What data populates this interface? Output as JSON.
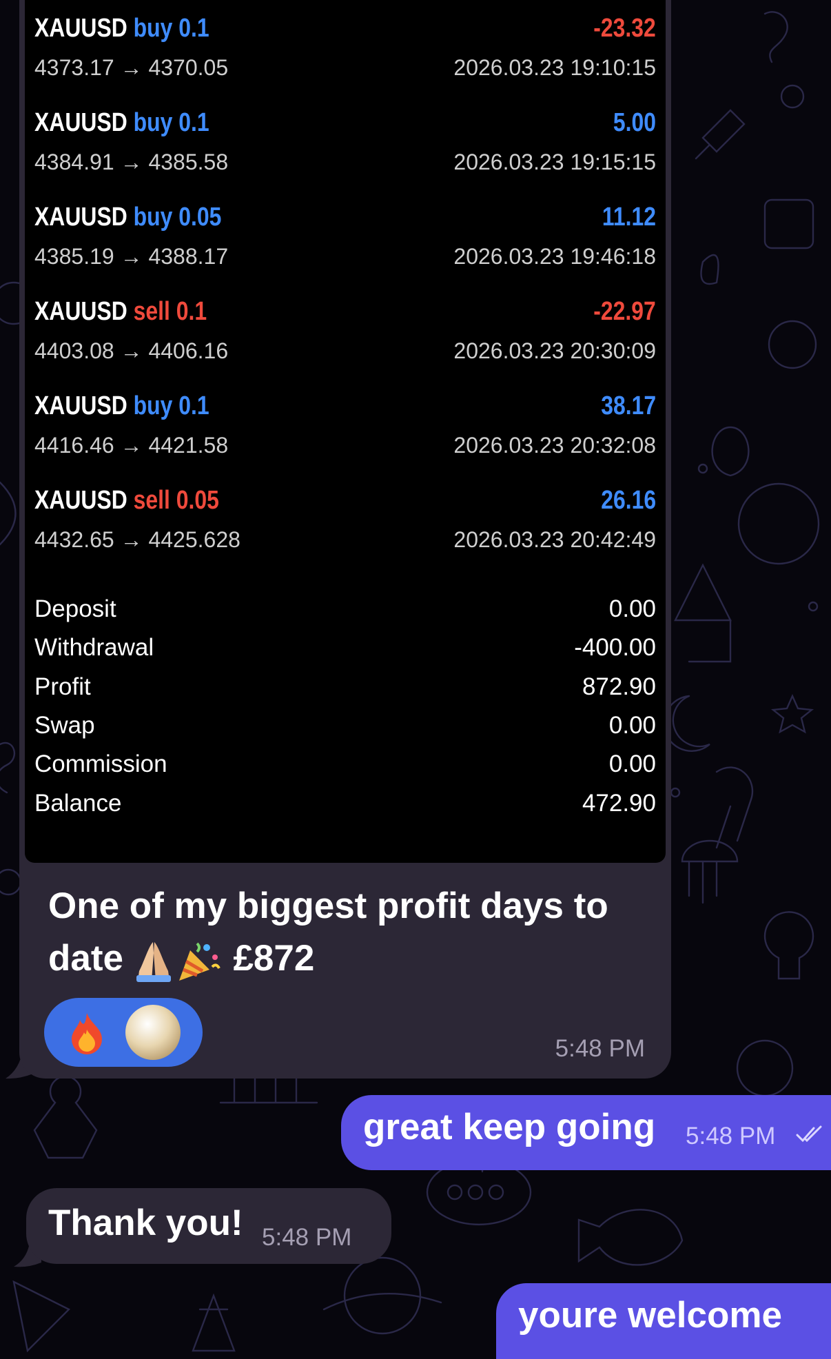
{
  "trades": [
    {
      "symbol": "XAUUSD",
      "side": "buy",
      "volume": "0.1",
      "prices": "4373.17 → 4370.05",
      "profit": "-23.32",
      "profit_sign": "neg",
      "time": "2026.03.23 19:10:15"
    },
    {
      "symbol": "XAUUSD",
      "side": "buy",
      "volume": "0.1",
      "prices": "4384.91 → 4385.58",
      "profit": "5.00",
      "profit_sign": "pos",
      "time": "2026.03.23 19:15:15"
    },
    {
      "symbol": "XAUUSD",
      "side": "buy",
      "volume": "0.05",
      "prices": "4385.19 → 4388.17",
      "profit": "11.12",
      "profit_sign": "pos",
      "time": "2026.03.23 19:46:18"
    },
    {
      "symbol": "XAUUSD",
      "side": "sell",
      "volume": "0.1",
      "prices": "4403.08 → 4406.16",
      "profit": "-22.97",
      "profit_sign": "neg",
      "time": "2026.03.23 20:30:09"
    },
    {
      "symbol": "XAUUSD",
      "side": "buy",
      "volume": "0.1",
      "prices": "4416.46 → 4421.58",
      "profit": "38.17",
      "profit_sign": "pos",
      "time": "2026.03.23 20:32:08"
    },
    {
      "symbol": "XAUUSD",
      "side": "sell",
      "volume": "0.05",
      "prices": "4432.65 → 4425.628",
      "profit": "26.16",
      "profit_sign": "pos",
      "time": "2026.03.23 20:42:49"
    }
  ],
  "summary": [
    {
      "label": "Deposit",
      "value": "0.00"
    },
    {
      "label": "Withdrawal",
      "value": "-400.00"
    },
    {
      "label": "Profit",
      "value": "872.90"
    },
    {
      "label": "Swap",
      "value": "0.00"
    },
    {
      "label": "Commission",
      "value": "0.00"
    },
    {
      "label": "Balance",
      "value": "472.90"
    }
  ],
  "messages": {
    "screenshot_message": {
      "caption_line1": "One of my biggest profit days to",
      "caption_word": "date",
      "caption_amount": "£872",
      "time": "5:48 PM",
      "reactions": [
        "fire-emoji",
        "avatar"
      ]
    },
    "outgoing_1": {
      "text": "great keep going",
      "time": "5:48 PM",
      "status_icon": "double-check-icon"
    },
    "incoming_1": {
      "text": "Thank you!",
      "time": "5:48 PM"
    },
    "outgoing_2": {
      "text": "youre welcome"
    }
  },
  "colors": {
    "buy": "#3f8cff",
    "sell": "#ef4a3c",
    "loss": "#ef4a3c",
    "gain": "#3f8cff",
    "incoming_bubble": "#2c2736",
    "outgoing_bubble": "#5b50e4",
    "reaction_pill": "#3d6fe4",
    "background": "#07060d"
  }
}
